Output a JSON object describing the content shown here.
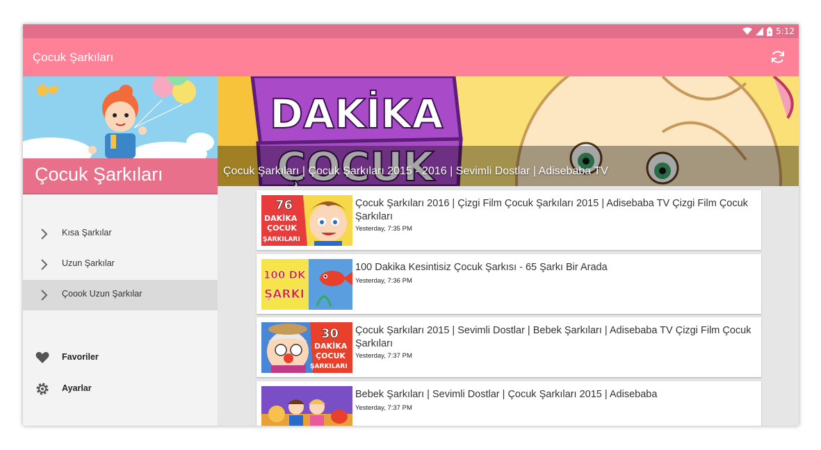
{
  "status_bar": {
    "time": "5:12",
    "icons": [
      "wifi-icon",
      "signal-icon",
      "battery-icon"
    ]
  },
  "app_bar": {
    "title": "Çocuk Şarkıları",
    "refresh_icon": "refresh-icon"
  },
  "drawer": {
    "header_title": "Çocuk Şarkıları",
    "nav_items": [
      {
        "label": "Kısa Şarkılar",
        "selected": false
      },
      {
        "label": "Uzun Şarkılar",
        "selected": false
      },
      {
        "label": "Çoook Uzun Şarkılar",
        "selected": true
      }
    ],
    "menu_items": [
      {
        "label": "Favoriler",
        "icon": "heart-icon"
      },
      {
        "label": "Ayarlar",
        "icon": "gear-icon"
      }
    ]
  },
  "banner": {
    "caption": "Çocuk Şarkıları | Çocuk Şarkıları 2015 - 2016 | Sevimli Dostlar | Adisebaba TV",
    "artwork_text": [
      "DAKİKA",
      "ÇOCUK"
    ]
  },
  "videos": [
    {
      "title": "Çocuk Şarkıları 2016 | Çizgi Film Çocuk Şarkıları 2015 | Adisebaba TV Çizgi Film Çocuk Şarkıları",
      "time": "Yesterday, 7:35 PM",
      "thumb_text": [
        "76",
        "DAKİKA",
        "ÇOCUK",
        "ŞARKILARI"
      ]
    },
    {
      "title": "100 Dakika Kesintisiz Çocuk Şarkısı - 65 Şarkı Bir Arada",
      "time": "Yesterday, 7:36 PM",
      "thumb_text": [
        "100 DK",
        "ŞARKI"
      ]
    },
    {
      "title": "Çocuk Şarkıları 2015 | Sevimli Dostlar | Bebek Şarkıları | Adisebaba TV Çizgi Film Çocuk Şarkıları",
      "time": "Yesterday, 7:37 PM",
      "thumb_text": [
        "30",
        "DAKİKA",
        "ÇOCUK",
        "ŞARKILARI"
      ]
    },
    {
      "title": "Bebek Şarkıları | Sevimli Dostlar | Çocuk Şarkıları 2015 | Adisebaba",
      "time": "Yesterday, 7:37 PM",
      "thumb_text": []
    }
  ],
  "colors": {
    "status_bar": "#e26e89",
    "app_bar": "#ff8197",
    "drawer_band": "#e8708a",
    "selected_item": "#dadada"
  }
}
